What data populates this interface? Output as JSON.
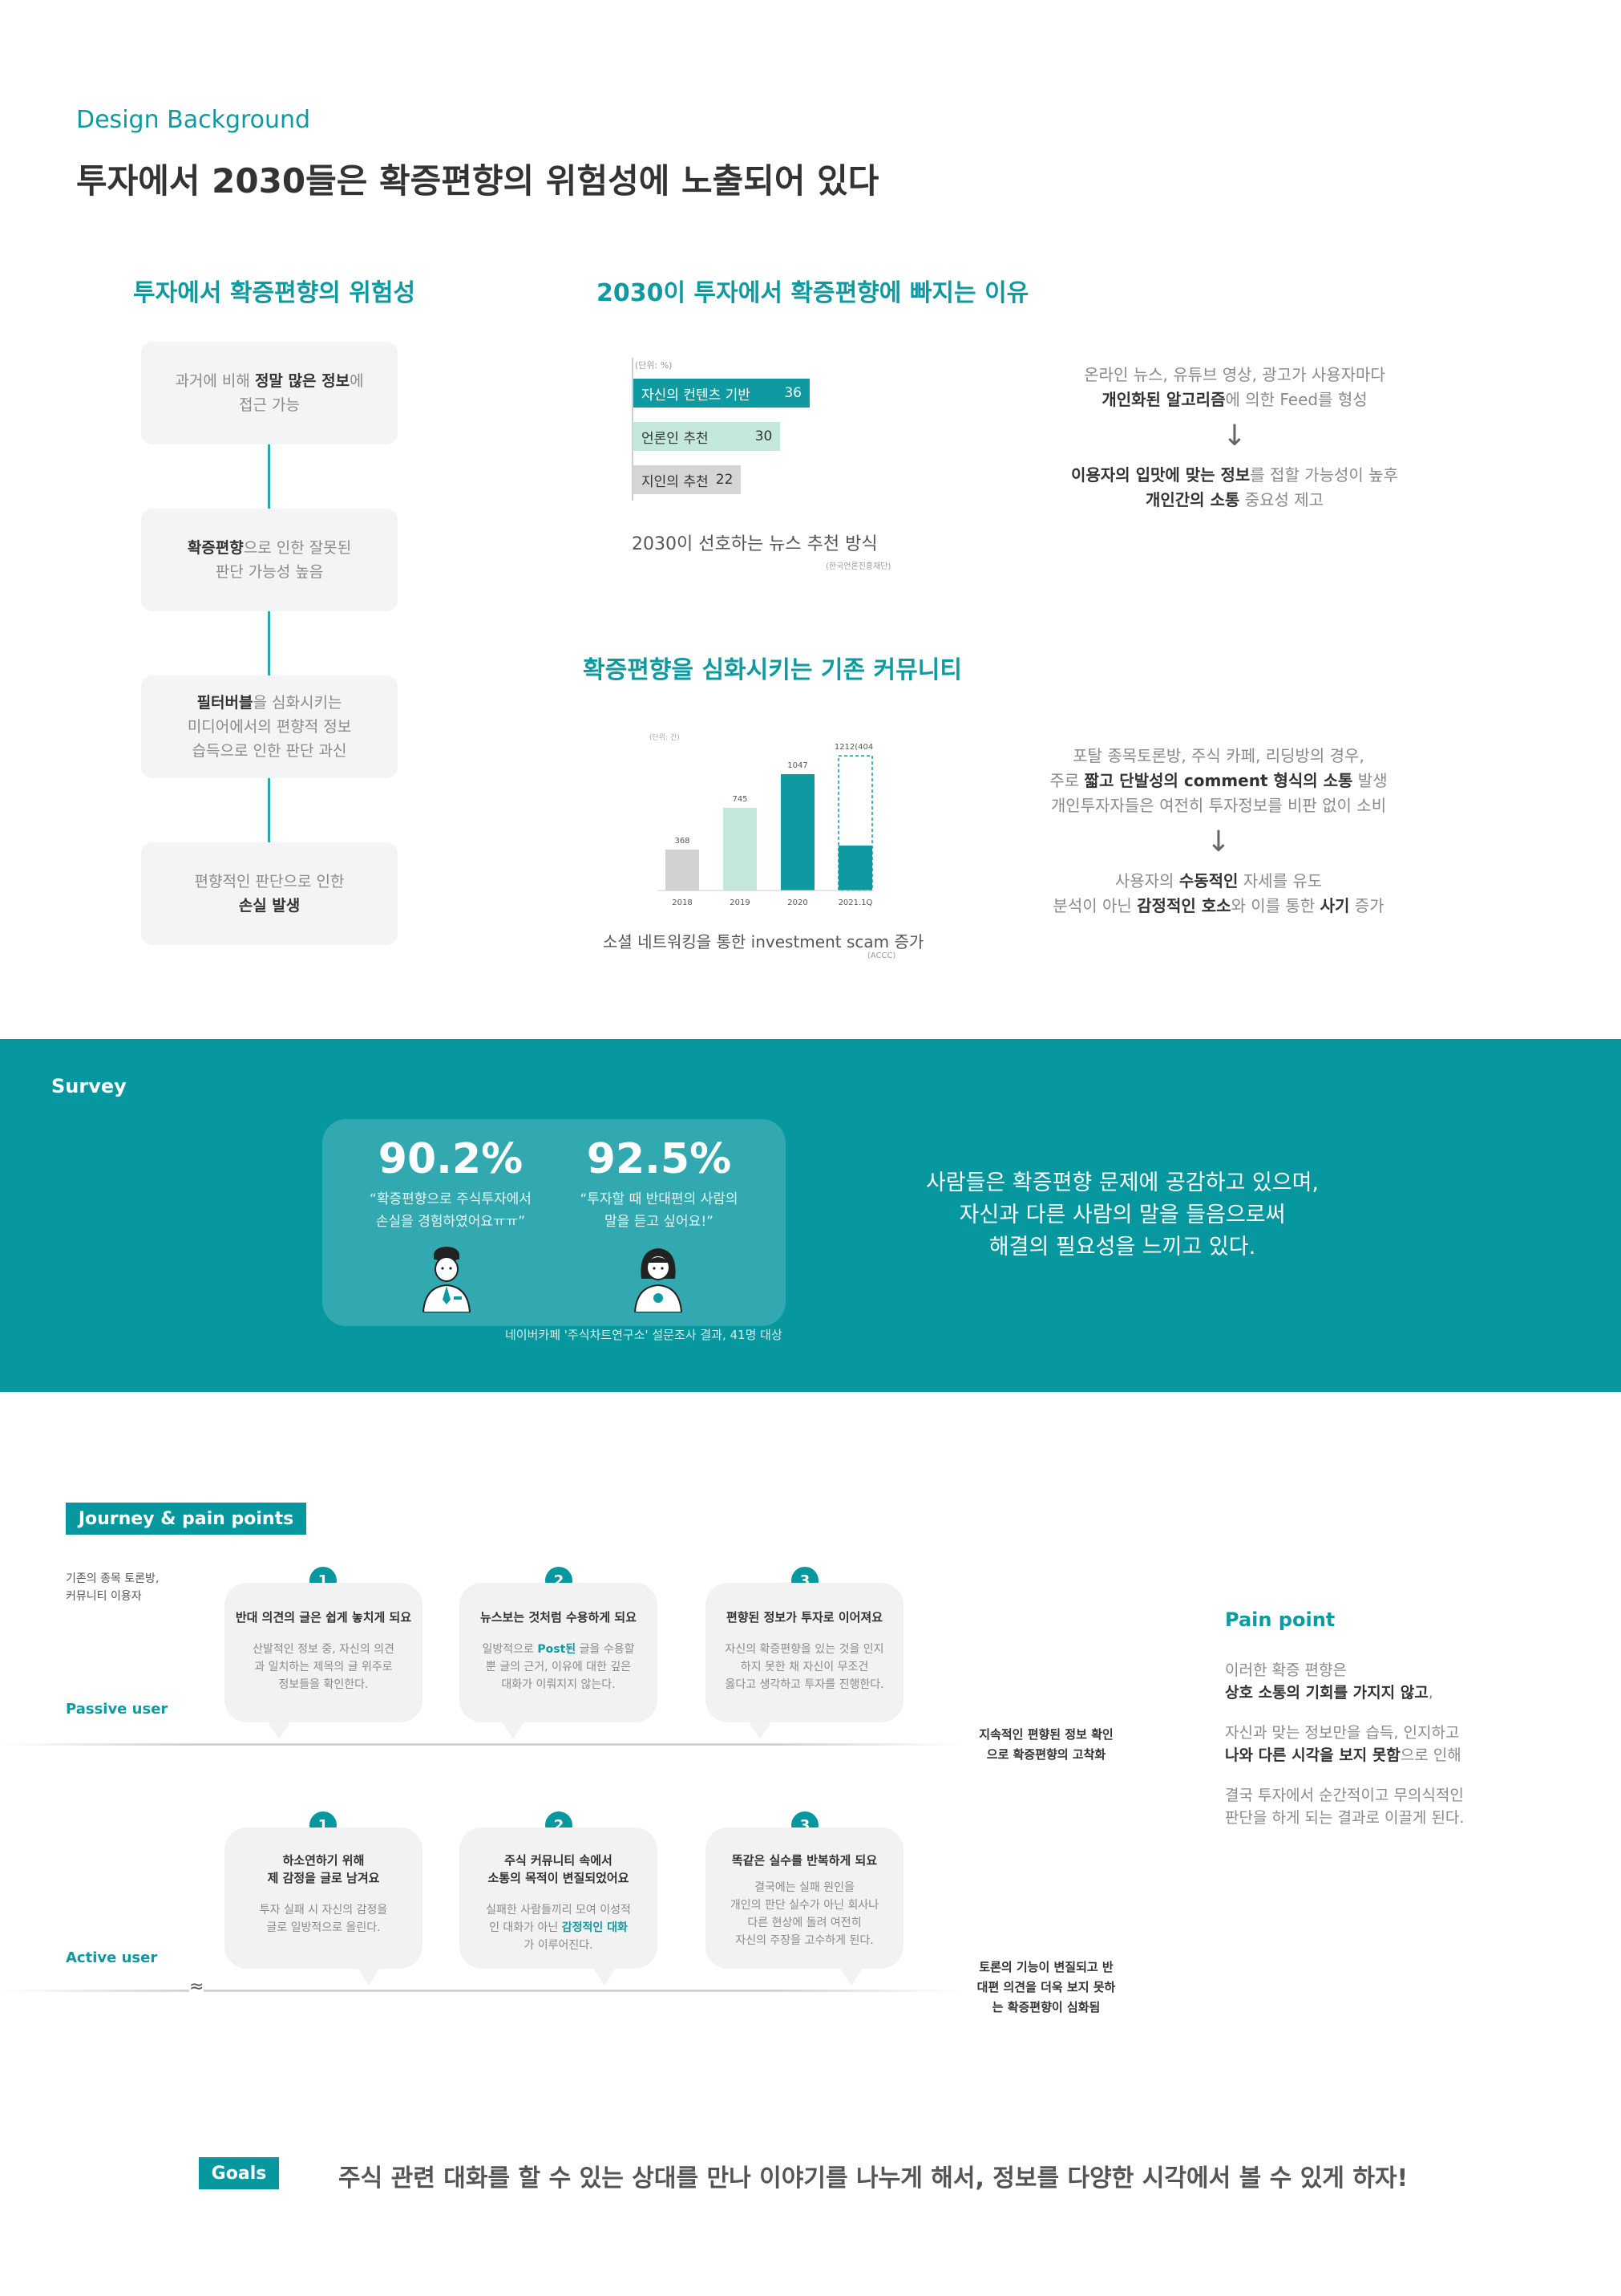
{
  "header": {
    "eyebrow": "Design Background",
    "title": "투자에서 2030들은 확증편향의 위험성에 노출되어 있다"
  },
  "risk": {
    "title": "투자에서 확증편향의 위험성",
    "boxes": [
      {
        "pre": "과거에 비해 ",
        "strong": "정말 많은 정보",
        "post": "에",
        "line2": "접근 가능"
      },
      {
        "strong": "확증편향",
        "post": "으로 인한 잘못된",
        "line2": "판단 가능성 높음"
      },
      {
        "strong": "필터버블",
        "post": "을 심화시키는",
        "line2": "미디어에서의 편향적 정보",
        "line3": "습득으로 인한 판단 과신"
      },
      {
        "line1": "편향적인 판단으로 인한",
        "strong": "손실 발생"
      }
    ]
  },
  "reasons": {
    "title": "2030이 투자에서 확증편향에 빠지는 이유",
    "unit": "(단위: %)",
    "bars": [
      {
        "label": "자신의 컨텐츠 기반",
        "value": 36,
        "color": "#0f9aa1",
        "text_color": "#ffffff"
      },
      {
        "label": "언론인 추천",
        "value": 30,
        "color": "#c4e9dc",
        "text_color": "#333333"
      },
      {
        "label": "지인의 추천",
        "value": 22,
        "color": "#d5d5d5",
        "text_color": "#333333"
      }
    ],
    "value_labels": [
      "36",
      "30",
      "22"
    ],
    "caption": "2030이 선호하는 뉴스 추천 방식",
    "source": "(한국언론진흥재단)",
    "expl": {
      "l1": "온라인 뉴스, 유튜브 영상, 광고가 사용자마다",
      "l2_strong": "개인화된 알고리즘",
      "l2_post": "에 의한 Feed를 형성",
      "arrow": "↓",
      "l3_strong": "이용자의 입맛에 맞는 정보",
      "l3_post": "를 접할 가능성이 높후",
      "l4_strong": "개인간의 소통",
      "l4_post": " 중요성 제고"
    }
  },
  "community": {
    "title": "확증편향을 심화시키는 기존 커뮤니티",
    "caption": "소셜 네트워킹을 통한 investment scam 증가",
    "source": "(ACCC)",
    "expl": {
      "l1": "포탈 종목토론방, 주식 카페, 리딩방의 경우,",
      "l2_pre": "주로 ",
      "l2_strong": "짧고 단발성의 comment 형식의 소통",
      "l2_post": " 발생",
      "l3": "개인투자자들은 여전히 투자정보를 비판 없이 소비",
      "arrow": "↓",
      "l4_pre": "사용자의 ",
      "l4_strong": "수동적인",
      "l4_post": " 자세를 유도",
      "l5_pre": "분석이 아닌 ",
      "l5_s1": "감정적인 호소",
      "l5_mid": "와 이를 통한 ",
      "l5_s2": "사기",
      "l5_post": " 증가"
    }
  },
  "chart_data": {
    "type": "bar",
    "title": "",
    "unit_label": "(단위: 건)",
    "categories": [
      "2018",
      "2019",
      "2020",
      "2021.1Q"
    ],
    "values": [
      368,
      745,
      1047,
      404
    ],
    "value_labels": [
      "368",
      "745",
      "1047",
      "1212(404)"
    ],
    "projected_value": 1212,
    "colors": [
      "#d2d2d2",
      "#c4e9dc",
      "#0f9aa1",
      "#0f9aa1"
    ],
    "ylim": [
      0,
      1300
    ],
    "grid": false
  },
  "survey": {
    "label": "Survey",
    "stats": [
      {
        "value": "90.2%",
        "quote1": "“확증편향으로 주식투자에서",
        "quote2": "손실을 경험하였어요ㅠㅠ”",
        "icon": "man-avatar-icon"
      },
      {
        "value": "92.5%",
        "quote1": "“투자할 때 반대편의 사람의",
        "quote2": "말을 듣고 싶어요!”",
        "icon": "woman-avatar-icon"
      }
    ],
    "source": "네이버카페 '주식차트연구소' 설문조사 결과, 41명 대상",
    "message": [
      "사람들은 확증편향 문제에 공감하고 있으며,",
      "자신과 다른 사람의 말을 들음으로써",
      "해결의 필요성을 느끼고 있다."
    ]
  },
  "journey": {
    "tag": "Journey & pain points",
    "context": [
      "기존의 종목 토론방,",
      "커뮤니티 이용자"
    ],
    "passive_label": "Passive user",
    "active_label": "Active user",
    "wave": "≈",
    "passive": [
      {
        "num": "1",
        "title": [
          "반대 의견의 글은 쉽게 놓치게 되요"
        ],
        "body": [
          "산발적인 정보 중, 자신의 의견",
          "과 일치하는 제목의 글 위주로",
          "정보들을 확인한다."
        ]
      },
      {
        "num": "2",
        "title": [
          "뉴스보는 것처럼 수용하게 되요"
        ],
        "body_pre": "일방적으로 ",
        "body_hl": "Post된",
        "body_post": " 글을 수용할",
        "body": [
          "뿐 글의 근거, 이유에 대한 깊은",
          "대화가 이뤄지지 않는다."
        ]
      },
      {
        "num": "3",
        "title": [
          "편향된 정보가 투자로 이어져요"
        ],
        "body": [
          "자신의 확증편향을 있는 것을 인지",
          "하지 못한 채 자신이 무조건",
          "옳다고 생각하고 투자를 진행한다."
        ]
      }
    ],
    "active": [
      {
        "num": "1",
        "title": [
          "하소연하기 위해",
          "제 감정을 글로 남겨요"
        ],
        "body": [
          "투자 실패 시 자신의 감정을",
          "글로 일방적으로 올린다."
        ]
      },
      {
        "num": "2",
        "title": [
          "주식 커뮤니티 속에서",
          "소통의 목적이 변질되었어요"
        ],
        "body": [
          "실패한 사람들끼리 모여 이성적",
          "인 대화가 아닌 "
        ],
        "body_hl": "감정적인 대화",
        "body_last": "가 이루어진다."
      },
      {
        "num": "3",
        "title": [
          "똑같은 실수를 반복하게 되요"
        ],
        "body": [
          "결국에는 실패 원인을",
          "개인의 판단 실수가 아닌 회사나",
          "다른 현상에 돌려 여전히",
          "자신의 주장을 고수하게 된다."
        ]
      }
    ],
    "passive_note": [
      "지속적인 편향된 정보 확인",
      "으로 확증편향의 고착화"
    ],
    "active_note": [
      "토론의 기능이 변질되고 반",
      "대편 의견을 더욱 보지 못하",
      "는 확증편향이 심화됨"
    ]
  },
  "pain_point": {
    "title": "Pain point",
    "p1_l1": "이러한 확증 편향은",
    "p1_strong": "상호 소통의 기회를 가지지 않고",
    "p1_post": ",",
    "p2_l1": "자신과 맞는 정보만을 습득, 인지하고",
    "p2_strong": "나와 다른 시각을 보지 못함",
    "p2_post": "으로 인해",
    "p3_l1": "결국 투자에서 순간적이고 무의식적인",
    "p3_l2": "판단을 하게 되는 결과로 이끌게 된다."
  },
  "goals": {
    "tag": "Goals",
    "text": "주식 관련 대화를 할 수 있는 상대를 만나 이야기를 나누게 해서, 정보를 다양한 시각에서 볼 수 있게 하자!"
  }
}
